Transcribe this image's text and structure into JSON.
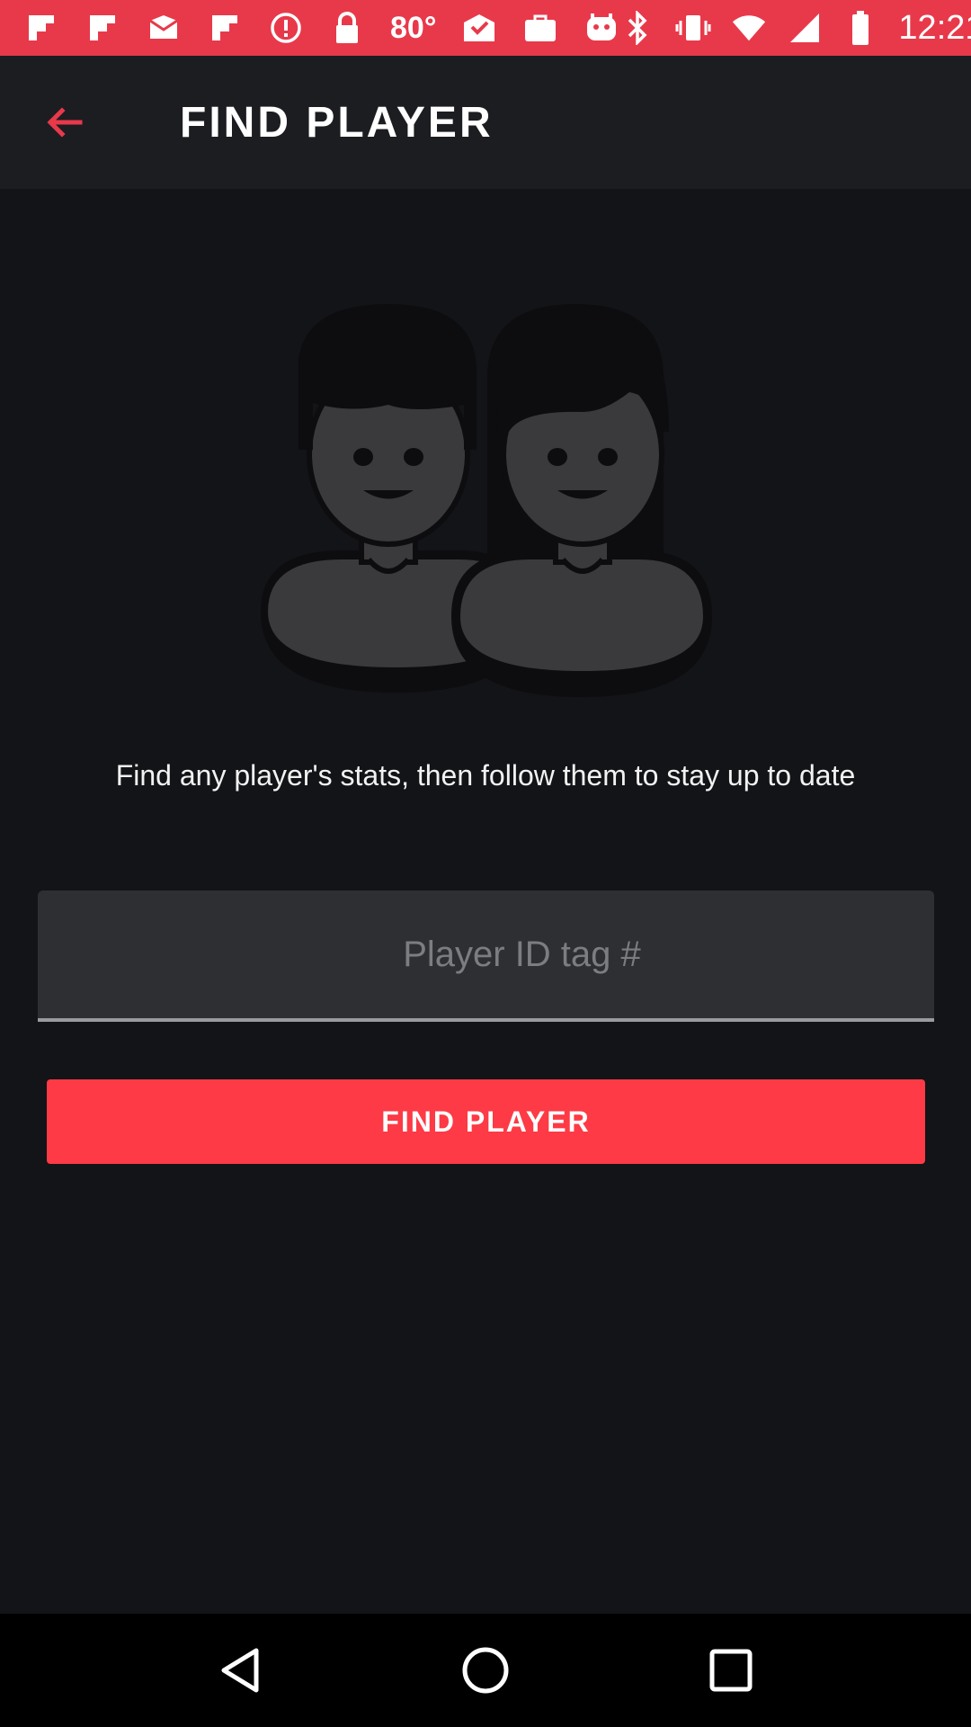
{
  "status_bar": {
    "temperature": "80°",
    "time": "12:21",
    "color": "#e8394a",
    "left_icons": [
      "flipboard-icon",
      "flipboard-icon",
      "mail-icon",
      "flipboard-icon",
      "alert-icon",
      "lock-icon",
      "temperature-text",
      "mail-check-icon",
      "briefcase-icon",
      "robot-icon"
    ],
    "right_icons": [
      "bluetooth-icon",
      "vibrate-icon",
      "wifi-icon",
      "signal-icon",
      "battery-icon"
    ]
  },
  "app_bar": {
    "title": "FIND PLAYER",
    "back_icon": "arrow-left-icon",
    "accent": "#e8394a"
  },
  "hero": {
    "icon": "two-players-icon"
  },
  "main": {
    "tagline": "Find any player's stats, then follow them to stay up to date",
    "input": {
      "placeholder": "Player ID tag #",
      "value": ""
    },
    "button_label": "FIND PLAYER",
    "button_color": "#fd3a45"
  },
  "nav_bar": {
    "items": [
      "back-triangle-icon",
      "home-circle-icon",
      "recents-square-icon"
    ]
  }
}
